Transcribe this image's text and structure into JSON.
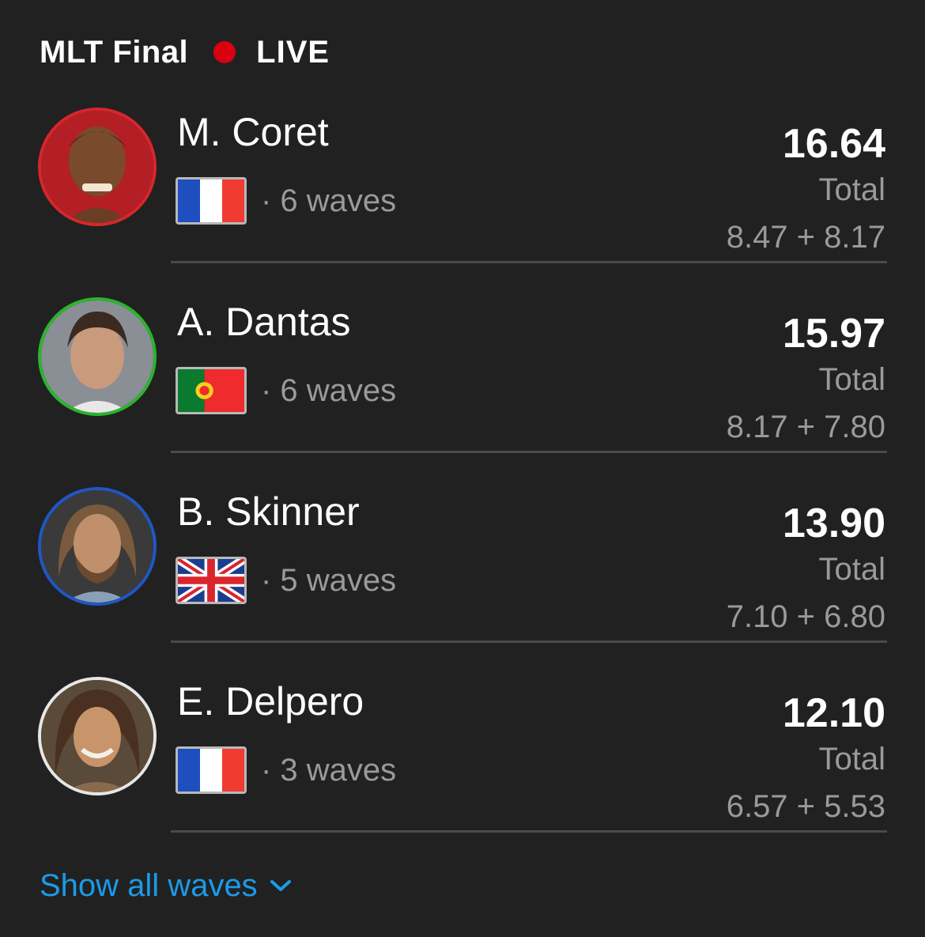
{
  "header": {
    "title": "MLT Final",
    "live_label": "LIVE",
    "live_color": "#d90010"
  },
  "surfers": [
    {
      "name": "M. Coret",
      "flag": "france-flag",
      "waves": "· 6 waves",
      "total": "16.64",
      "total_label": "Total",
      "breakdown": "8.47 + 8.17",
      "ring_color": "#d8262c"
    },
    {
      "name": "A. Dantas",
      "flag": "portugal-flag",
      "waves": "· 6 waves",
      "total": "15.97",
      "total_label": "Total",
      "breakdown": "8.17 + 7.80",
      "ring_color": "#2bb52b"
    },
    {
      "name": "B. Skinner",
      "flag": "uk-flag",
      "waves": "· 5 waves",
      "total": "13.90",
      "total_label": "Total",
      "breakdown": "7.10 + 6.80",
      "ring_color": "#1f57c4"
    },
    {
      "name": "E. Delpero",
      "flag": "france-flag",
      "waves": "· 3 waves",
      "total": "12.10",
      "total_label": "Total",
      "breakdown": "6.57 + 5.53",
      "ring_color": "#e6e6e6"
    }
  ],
  "footer": {
    "show_all_label": "Show all waves",
    "link_color": "#1a9bea"
  }
}
